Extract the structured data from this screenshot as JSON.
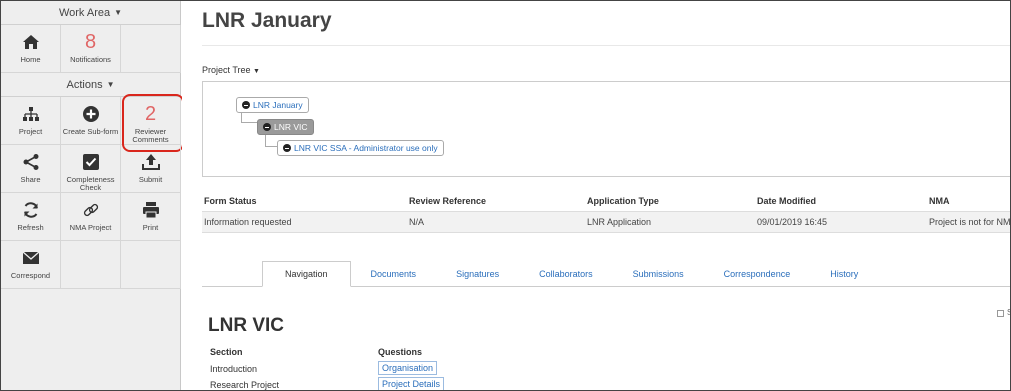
{
  "sidebar": {
    "work_area": {
      "label": "Work Area",
      "chevron": "chevron-down-icon"
    },
    "home": {
      "label": "Home",
      "icon": "home-icon"
    },
    "notifications": {
      "count": "8",
      "label": "Notifications"
    },
    "actions": {
      "label": "Actions",
      "chevron": "chevron-down-icon"
    },
    "project": {
      "label": "Project",
      "icon": "sitemap-icon"
    },
    "create_sub_form": {
      "label": "Create Sub-form",
      "icon": "plus-circle-icon"
    },
    "reviewer_comments": {
      "count": "2",
      "label": "Reviewer Comments"
    },
    "share": {
      "label": "Share",
      "icon": "share-icon"
    },
    "completeness_check": {
      "label": "Completeness Check",
      "icon": "checkbox-icon"
    },
    "submit": {
      "label": "Submit",
      "icon": "upload-icon"
    },
    "refresh": {
      "label": "Refresh",
      "icon": "refresh-icon"
    },
    "nma_project": {
      "label": "NMA Project",
      "icon": "link-icon"
    },
    "print": {
      "label": "Print",
      "icon": "printer-icon"
    },
    "correspond": {
      "label": "Correspond",
      "icon": "envelope-icon"
    }
  },
  "main": {
    "title": "LNR January",
    "project_tree_label": "Project Tree",
    "tree": {
      "root": "LNR January",
      "child": "LNR VIC",
      "grandchild": "LNR VIC SSA - Administrator use only"
    },
    "status_table": {
      "headers": [
        "Form Status",
        "Review Reference",
        "Application Type",
        "Date Modified",
        "NMA"
      ],
      "row": [
        "Information requested",
        "N/A",
        "LNR Application",
        "09/01/2019 16:45",
        "Project is not for NMA"
      ]
    },
    "tabs": [
      "Navigation",
      "Documents",
      "Signatures",
      "Collaborators",
      "Submissions",
      "Correspondence",
      "History"
    ],
    "form_title": "LNR VIC",
    "questions_table": {
      "section_header": "Section",
      "questions_header": "Questions",
      "rows": [
        {
          "section": "Introduction",
          "question": "Organisation"
        },
        {
          "section": "Research Project",
          "question": "Project Details"
        }
      ]
    },
    "edge_label": "S"
  },
  "colors": {
    "accent_link": "#2a6ebb",
    "count_red": "#e06666",
    "highlight_red": "#d9261c",
    "sidebar_bg": "#eeeeee"
  }
}
